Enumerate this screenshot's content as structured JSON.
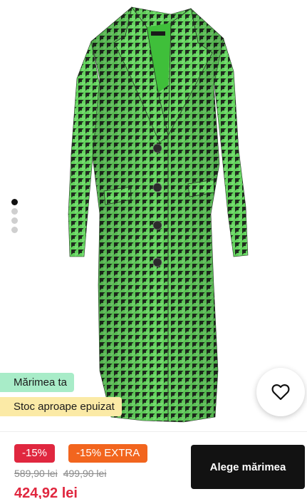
{
  "gallery": {
    "image_alt": "",
    "total_images": 4,
    "active_index": 0
  },
  "badges": {
    "size_label": "Mărimea ta",
    "stock_label": "Stoc aproape epuizat"
  },
  "wishlist": {
    "icon": "heart-icon"
  },
  "pricing": {
    "discount_badge": "-15%",
    "extra_discount_badge": "-15% EXTRA",
    "original_price": "589,90 lei",
    "previous_price": "499,90 lei",
    "final_price": "424,92 lei"
  },
  "cta": {
    "label": "Alege mărimea"
  },
  "colors": {
    "coat_green": "#5fcf5a",
    "houndstooth_dark": "#1e2a1d",
    "sale_red": "#e0273f",
    "extra_orange": "#f2651e",
    "size_badge_bg": "#a8ecc8",
    "stock_badge_bg": "#fbeaa6",
    "cta_bg": "#121212"
  }
}
